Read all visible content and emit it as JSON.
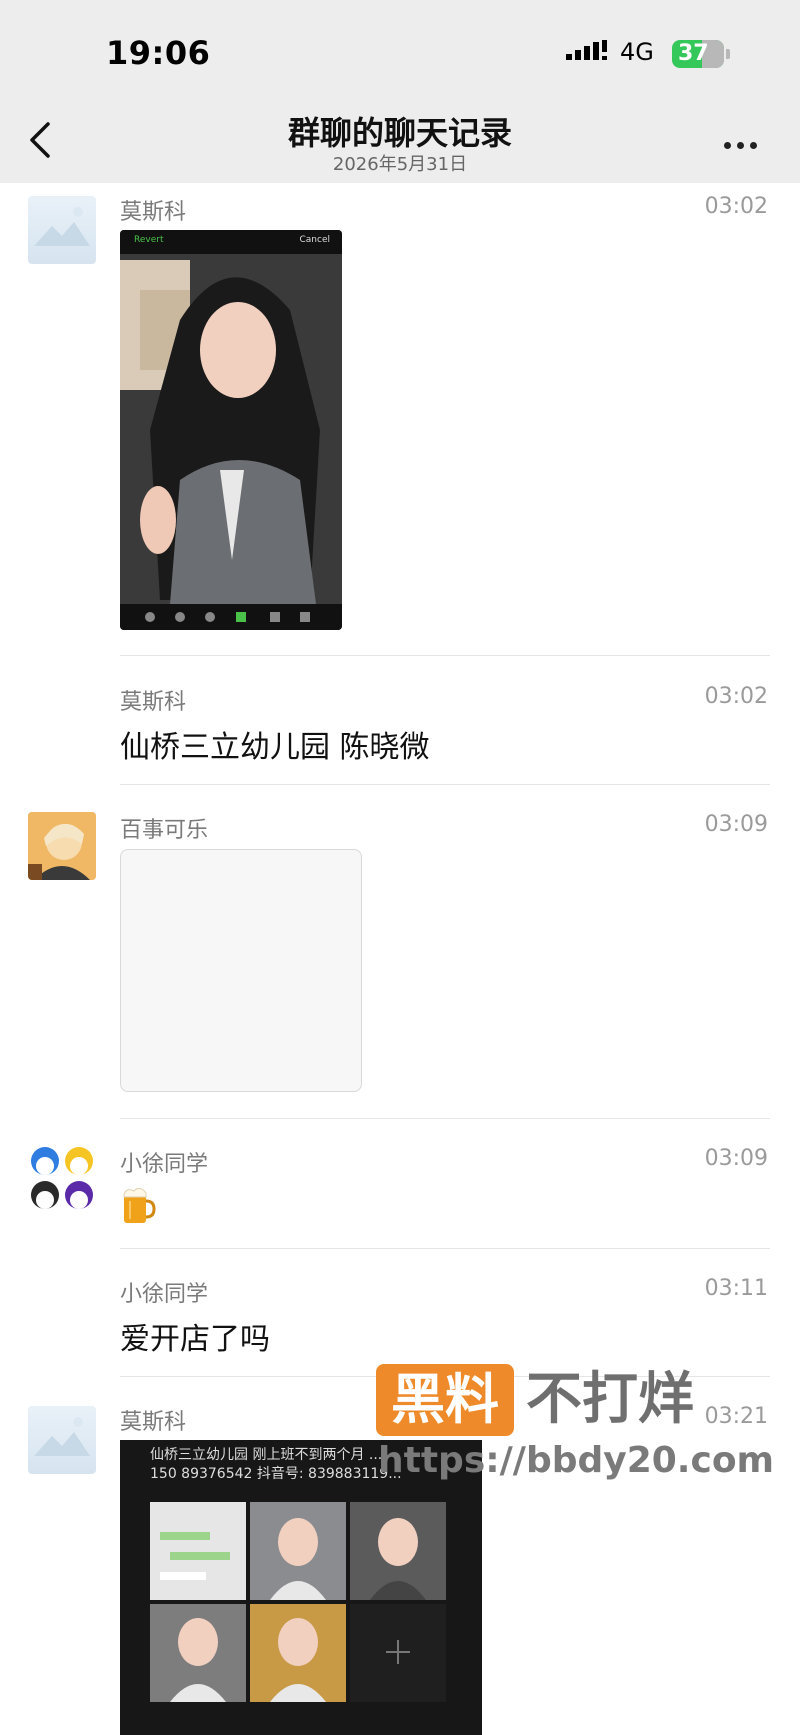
{
  "status_bar": {
    "time": "19:06",
    "network": "4G",
    "battery": "37"
  },
  "header": {
    "title": "群聊的聊天记录",
    "subtitle": "2026年5月31日"
  },
  "messages": [
    {
      "sender": "莫斯科",
      "time": "03:02",
      "type": "image",
      "image_toolbar": [
        "Revert",
        "Cancel"
      ]
    },
    {
      "sender": "莫斯科",
      "time": "03:02",
      "type": "text",
      "text": "仙桥三立幼儿园 陈晓微"
    },
    {
      "sender": "百事可乐",
      "time": "03:09",
      "type": "image-placeholder"
    },
    {
      "sender": "小徐同学",
      "time": "03:09",
      "type": "emoji",
      "emoji": "beer-mug-icon"
    },
    {
      "sender": "小徐同学",
      "time": "03:11",
      "type": "text",
      "text": "爱开店了吗"
    },
    {
      "sender": "莫斯科",
      "time": "03:21",
      "type": "image",
      "image_caption": "仙桥三立幼儿园 刚上班不到两个月 ...\n150 89376542 抖音号: 839883119..."
    }
  ],
  "watermark": {
    "box": "黑料",
    "big": "不打烊",
    "url": "https://bbdy20.com"
  },
  "colors": {
    "header_bg": "#ededed",
    "battery": "#34c759",
    "watermark": "#ef8a2a"
  }
}
